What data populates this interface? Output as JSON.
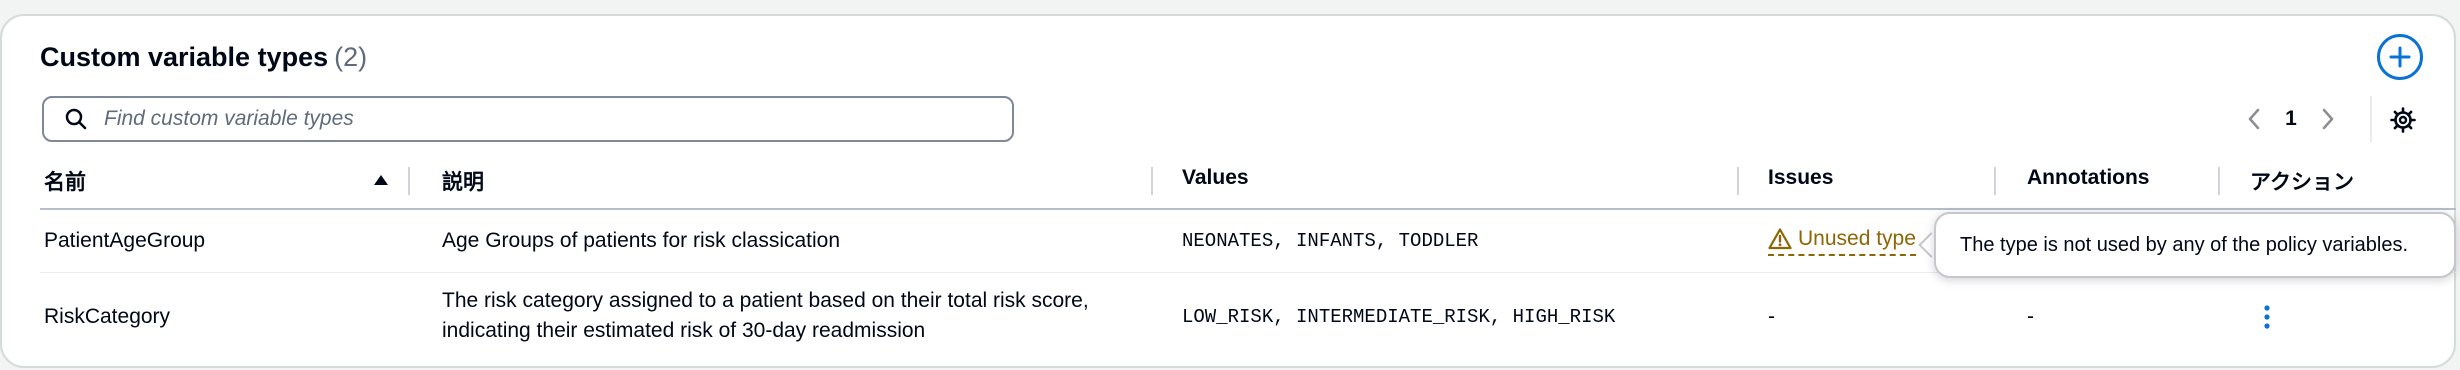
{
  "header": {
    "title": "Custom variable types",
    "count": "(2)"
  },
  "search": {
    "placeholder": "Find custom variable types",
    "value": ""
  },
  "pagination": {
    "current_page": "1"
  },
  "table": {
    "columns": {
      "name": "名前",
      "description": "説明",
      "values": "Values",
      "issues": "Issues",
      "annotations": "Annotations",
      "actions": "アクション"
    },
    "sort": {
      "column": "name",
      "direction": "ascending"
    },
    "rows": [
      {
        "name": "PatientAgeGroup",
        "description": "Age Groups of patients for risk classication",
        "values": "NEONATES, INFANTS, TODDLER",
        "issue": "Unused type"
      },
      {
        "name": "RiskCategory",
        "description_line1": "The risk category assigned to a patient based on their total risk score,",
        "description_line2": "indicating their estimated risk of 30-day readmission",
        "values": "LOW_RISK, INTERMEDIATE_RISK, HIGH_RISK",
        "issue": "-",
        "annotations": "-"
      }
    ]
  },
  "popover": {
    "text": "The type is not used by any of the policy variables."
  },
  "colors": {
    "accent": "#0972d3",
    "warning": "#8d6605",
    "border": "#d5dbdb"
  },
  "icons": {
    "add": "plus-circle-icon",
    "search": "search-icon",
    "prev": "chevron-left-icon",
    "next": "chevron-right-icon",
    "settings": "gear-icon",
    "sort": "caret-up-icon",
    "warning": "warning-triangle-icon",
    "actions": "kebab-menu-icon"
  }
}
